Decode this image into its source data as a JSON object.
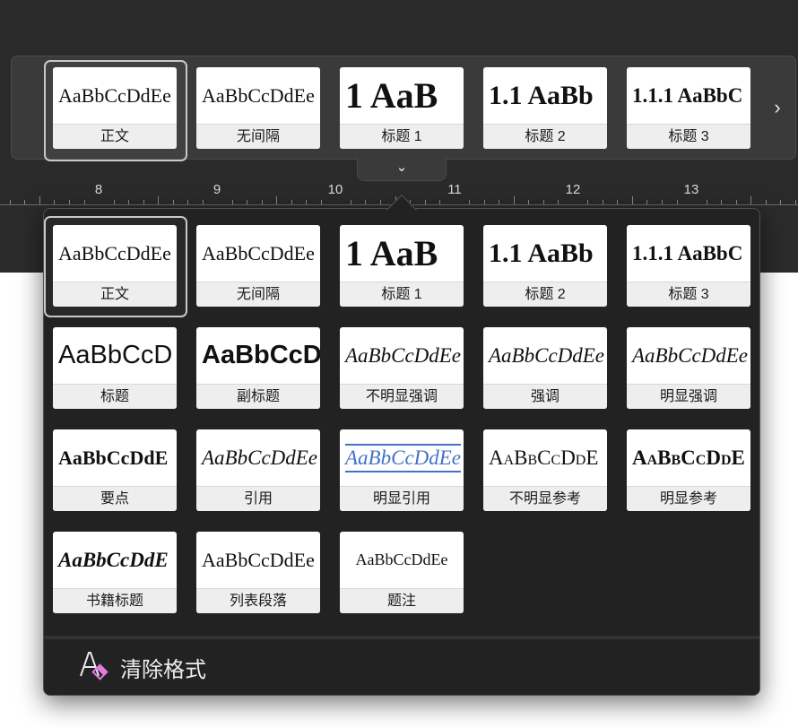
{
  "ribbon_gallery": {
    "tiles": [
      {
        "sample": "AaBbCcDdEe",
        "label": "正文"
      },
      {
        "sample": "AaBbCcDdEe",
        "label": "无间隔"
      },
      {
        "sample": "1  AaB",
        "label": "标题 1"
      },
      {
        "sample": "1.1  AaBb",
        "label": "标题 2"
      },
      {
        "sample": "1.1.1  AaBbC",
        "label": "标题 3"
      }
    ],
    "scroll_arrow": "›",
    "expand_chevron": "⌄"
  },
  "ruler": {
    "numbers": [
      "8",
      "9",
      "10",
      "11",
      "12",
      "13"
    ]
  },
  "styles_panel": {
    "rows": [
      [
        {
          "sample": "AaBbCcDdEe",
          "label": "正文"
        },
        {
          "sample": "AaBbCcDdEe",
          "label": "无间隔"
        },
        {
          "sample": "1  AaB",
          "label": "标题 1"
        },
        {
          "sample": "1.1  AaBb",
          "label": "标题 2"
        },
        {
          "sample": "1.1.1  AaBbC",
          "label": "标题 3"
        }
      ],
      [
        {
          "sample": "AaBbCcD",
          "label": "标题"
        },
        {
          "sample": "AaBbCcD",
          "label": "副标题"
        },
        {
          "sample": "AaBbCcDdEe",
          "label": "不明显强调"
        },
        {
          "sample": "AaBbCcDdEe",
          "label": "强调"
        },
        {
          "sample": "AaBbCcDdEe",
          "label": "明显强调"
        }
      ],
      [
        {
          "sample": "AaBbCcDdE",
          "label": "要点"
        },
        {
          "sample": "AaBbCcDdEe",
          "label": "引用"
        },
        {
          "sample": "AaBbCcDdEe",
          "label": "明显引用"
        },
        {
          "sample": "AaBbCcDdE",
          "label": "不明显参考"
        },
        {
          "sample": "AaBbCcDdE",
          "label": "明显参考"
        }
      ],
      [
        {
          "sample": "AaBbCcDdE",
          "label": "书籍标题"
        },
        {
          "sample": "AaBbCcDdEe",
          "label": "列表段落"
        },
        {
          "sample": "AaBbCcDdEe",
          "label": "题注"
        }
      ]
    ],
    "clear_formatting_label": "清除格式"
  },
  "colors": {
    "accent_blue": "#4472c4",
    "panel_bg": "#222223",
    "toolbar_bg": "#3a3a3b",
    "clear_icon_pink": "#e07be0"
  }
}
